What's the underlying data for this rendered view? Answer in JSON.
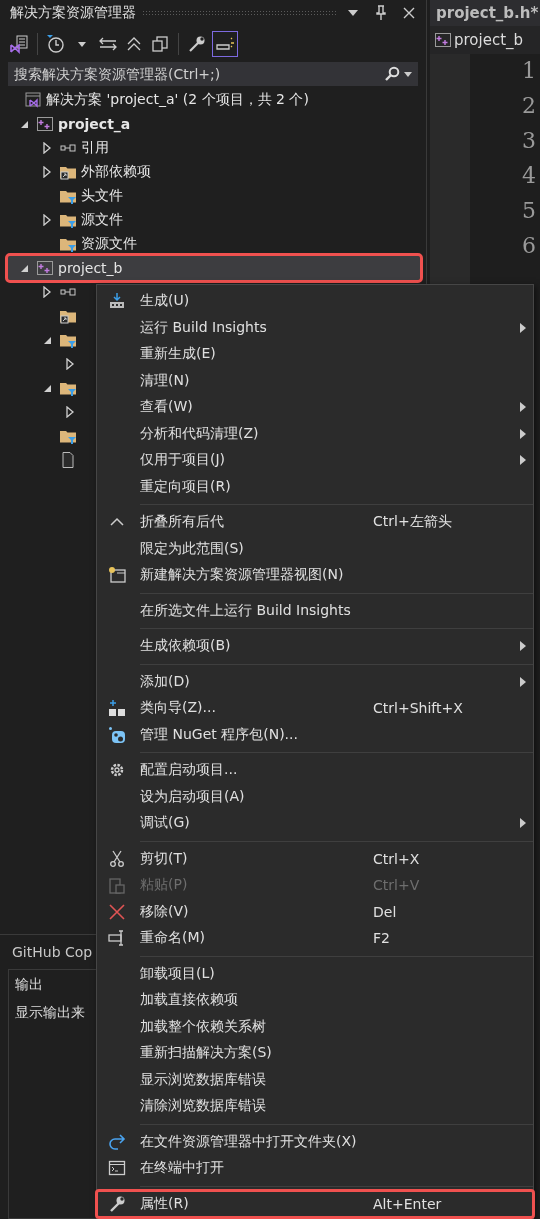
{
  "explorer": {
    "title": "解决方案资源管理器",
    "search": {
      "placeholder": "搜索解决方案资源管理器(Ctrl+;)"
    },
    "solution": {
      "label": "解决方案 'project_a' (2 个项目，共 2 个)",
      "selected": false
    },
    "tree": [
      {
        "kind": "project",
        "label": "project_a",
        "bold": true,
        "expanded": true,
        "selected": false,
        "highlighted": false,
        "children": [
          {
            "kind": "reference",
            "label": "引用",
            "expanded": false,
            "selected": false
          },
          {
            "kind": "link-folder",
            "label": "外部依赖项",
            "expanded": false,
            "selected": false
          },
          {
            "kind": "filter-folder",
            "label": "头文件",
            "selected": false
          },
          {
            "kind": "filter-folder",
            "label": "源文件",
            "expanded": false,
            "selected": false
          },
          {
            "kind": "filter-folder",
            "label": "资源文件",
            "selected": false
          }
        ]
      },
      {
        "kind": "project",
        "label": "project_b",
        "bold": false,
        "expanded": true,
        "selected": true,
        "highlighted": true,
        "children": [
          {
            "kind": "reference",
            "expanded": false,
            "selected": false
          },
          {
            "kind": "link-folder",
            "selected": false
          },
          {
            "kind": "filter-folder",
            "expanded": true,
            "selected": false,
            "children": [
              {
                "expanded": false,
                "selected": false
              }
            ]
          },
          {
            "kind": "filter-folder",
            "expanded": true,
            "selected": false,
            "children": [
              {
                "expanded": false,
                "selected": false
              }
            ]
          },
          {
            "kind": "filter-folder",
            "selected": false
          },
          {
            "kind": "file",
            "selected": false
          }
        ]
      }
    ]
  },
  "bottom_tab": "GitHub Cop",
  "output": {
    "title": "输出",
    "label": "显示输出来"
  },
  "editor": {
    "tab": "project_b.h*",
    "nav": "project_b",
    "line_numbers": [
      "1",
      "2",
      "3",
      "4",
      "5",
      "6"
    ]
  },
  "context_menu": [
    {
      "kind": "build",
      "label": "生成(U)"
    },
    {
      "kind": "item",
      "label": "运行 Build Insights",
      "submenu": true
    },
    {
      "kind": "item",
      "label": "重新生成(E)"
    },
    {
      "kind": "item",
      "label": "清理(N)"
    },
    {
      "kind": "item",
      "label": "查看(W)",
      "submenu": true
    },
    {
      "kind": "item",
      "label": "分析和代码清理(Z)",
      "submenu": true
    },
    {
      "kind": "item",
      "label": "仅用于项目(J)",
      "submenu": true
    },
    {
      "kind": "item",
      "label": "重定向项目(R)"
    },
    {
      "kind": "separator"
    },
    {
      "kind": "collapse",
      "label": "折叠所有后代",
      "shortcut": "Ctrl+左箭头"
    },
    {
      "kind": "item",
      "label": "限定为此范围(S)"
    },
    {
      "kind": "new-view",
      "label": "新建解决方案资源管理器视图(N)"
    },
    {
      "kind": "separator"
    },
    {
      "kind": "item",
      "label": "在所选文件上运行 Build Insights"
    },
    {
      "kind": "separator"
    },
    {
      "kind": "item",
      "label": "生成依赖项(B)",
      "submenu": true
    },
    {
      "kind": "separator"
    },
    {
      "kind": "item",
      "label": "添加(D)",
      "submenu": true
    },
    {
      "kind": "class-wizard",
      "label": "类向导(Z)...",
      "shortcut": "Ctrl+Shift+X"
    },
    {
      "kind": "nuget",
      "label": "管理 NuGet 程序包(N)..."
    },
    {
      "kind": "separator"
    },
    {
      "kind": "gear",
      "label": "配置启动项目..."
    },
    {
      "kind": "item",
      "label": "设为启动项目(A)"
    },
    {
      "kind": "item",
      "label": "调试(G)",
      "submenu": true
    },
    {
      "kind": "separator"
    },
    {
      "kind": "cut",
      "label": "剪切(T)",
      "shortcut": "Ctrl+X",
      "disabled": false
    },
    {
      "kind": "paste",
      "label": "粘贴(P)",
      "shortcut": "Ctrl+V",
      "disabled": true
    },
    {
      "kind": "remove",
      "label": "移除(V)",
      "shortcut": "Del",
      "disabled": false
    },
    {
      "kind": "rename",
      "label": "重命名(M)",
      "shortcut": "F2"
    },
    {
      "kind": "separator"
    },
    {
      "kind": "item",
      "label": "卸载项目(L)"
    },
    {
      "kind": "item",
      "label": "加载直接依赖项"
    },
    {
      "kind": "item",
      "label": "加载整个依赖关系树"
    },
    {
      "kind": "item",
      "label": "重新扫描解决方案(S)"
    },
    {
      "kind": "item",
      "label": "显示浏览数据库错误"
    },
    {
      "kind": "item",
      "label": "清除浏览数据库错误"
    },
    {
      "kind": "separator"
    },
    {
      "kind": "open-folder",
      "label": "在文件资源管理器中打开文件夹(X)"
    },
    {
      "kind": "terminal",
      "label": "在终端中打开"
    },
    {
      "kind": "separator"
    },
    {
      "kind": "wrench",
      "label": "属性(R)",
      "shortcut": "Alt+Enter",
      "highlighted": true
    }
  ]
}
